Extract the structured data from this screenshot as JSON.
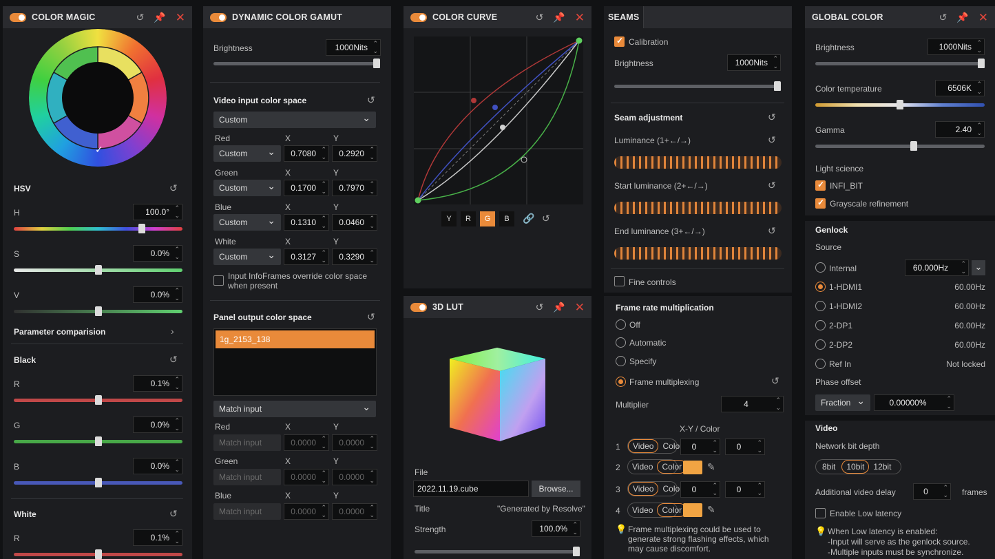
{
  "color_magic": {
    "title": "COLOR MAGIC",
    "hsv_label": "HSV",
    "h_label": "H",
    "h_value": "100.0°",
    "s_label": "S",
    "s_value": "0.0%",
    "v_label": "V",
    "v_value": "0.0%",
    "param_compare": "Parameter comparision",
    "black_label": "Black",
    "r_label": "R",
    "r_value": "0.1%",
    "g_label": "G",
    "g_value": "0.0%",
    "b_label": "B",
    "b_value": "0.0%",
    "white_label": "White",
    "wr_label": "R",
    "wr_value": "0.1%"
  },
  "gamut": {
    "title": "DYNAMIC COLOR GAMUT",
    "brightness_label": "Brightness",
    "brightness_value": "1000Nits",
    "input_cs_label": "Video input color space",
    "input_cs_value": "Custom",
    "x_label": "X",
    "y_label": "Y",
    "rows": [
      {
        "label": "Red",
        "mode": "Custom",
        "x": "0.7080",
        "y": "0.2920"
      },
      {
        "label": "Green",
        "mode": "Custom",
        "x": "0.1700",
        "y": "0.7970"
      },
      {
        "label": "Blue",
        "mode": "Custom",
        "x": "0.1310",
        "y": "0.0460"
      },
      {
        "label": "White",
        "mode": "Custom",
        "x": "0.3127",
        "y": "0.3290"
      }
    ],
    "infoframes_text": "Input InfoFrames override color space when present",
    "panel_cs_label": "Panel output color space",
    "panel_item": "1g_2153_138",
    "match_value": "Match input",
    "out_rows": [
      {
        "label": "Red",
        "mode": "Match input",
        "x": "0.0000",
        "y": "0.0000"
      },
      {
        "label": "Green",
        "mode": "Match input",
        "x": "0.0000",
        "y": "0.0000"
      },
      {
        "label": "Blue",
        "mode": "Match input",
        "x": "0.0000",
        "y": "0.0000"
      }
    ]
  },
  "curve": {
    "title": "COLOR CURVE",
    "buttons": [
      "Y",
      "R",
      "G",
      "B"
    ]
  },
  "lut": {
    "title": "3D LUT",
    "file_label": "File",
    "file_value": "2022.11.19.cube",
    "browse": "Browse...",
    "title_label": "Title",
    "title_value": "\"Generated by Resolve\"",
    "strength_label": "Strength",
    "strength_value": "100.0%"
  },
  "seams": {
    "tab": "SEAMS",
    "calibration": "Calibration",
    "brightness_label": "Brightness",
    "brightness_value": "1000Nits",
    "seam_adj": "Seam adjustment",
    "lum": "Luminance (1+←/→)",
    "start_lum": "Start luminance (2+←/→)",
    "end_lum": "End luminance (3+←/→)",
    "fine": "Fine controls"
  },
  "framerate": {
    "title": "Frame rate multiplication",
    "options": [
      "Off",
      "Automatic",
      "Specify",
      "Frame multiplexing"
    ],
    "multiplier_label": "Multiplier",
    "multiplier_value": "4",
    "xy_color": "X-Y / Color",
    "video": "Video",
    "color": "Color",
    "rows": [
      {
        "n": "1",
        "x": "0",
        "y": "0"
      },
      {
        "n": "2"
      },
      {
        "n": "3",
        "x": "0",
        "y": "0"
      },
      {
        "n": "4"
      }
    ],
    "warning": "Frame multiplexing could be used to generate strong flashing effects, which may cause discomfort."
  },
  "global": {
    "title": "GLOBAL COLOR",
    "brightness_label": "Brightness",
    "brightness_value": "1000Nits",
    "temp_label": "Color temperature",
    "temp_value": "6506K",
    "gamma_label": "Gamma",
    "gamma_value": "2.40",
    "light_science": "Light science",
    "infi": "INFI_BIT",
    "grayscale": "Grayscale refinement",
    "genlock": "Genlock",
    "source": "Source",
    "sources": [
      {
        "label": "Internal",
        "value": "60.000Hz"
      },
      {
        "label": "1-HDMI1",
        "value": "60.00Hz"
      },
      {
        "label": "1-HDMI2",
        "value": "60.00Hz"
      },
      {
        "label": "2-DP1",
        "value": "60.00Hz"
      },
      {
        "label": "2-DP2",
        "value": "60.00Hz"
      },
      {
        "label": "Ref In",
        "value": "Not locked"
      }
    ],
    "phase": "Phase offset",
    "fraction": "Fraction",
    "phase_value": "0.00000%",
    "video": "Video",
    "bitdepth": "Network bit depth",
    "bits": [
      "8bit",
      "10bit",
      "12bit"
    ],
    "delay_label": "Additional video delay",
    "delay_value": "0",
    "frames": "frames",
    "low_latency": "Enable Low latency",
    "ll_note1": "When Low latency is enabled:",
    "ll_note2": "-Input will serve as the genlock source.",
    "ll_note3": "-Multiple inputs must be synchronize."
  },
  "icons": {
    "reset": "reset-icon",
    "pin": "pin-icon",
    "close": "close-icon"
  }
}
